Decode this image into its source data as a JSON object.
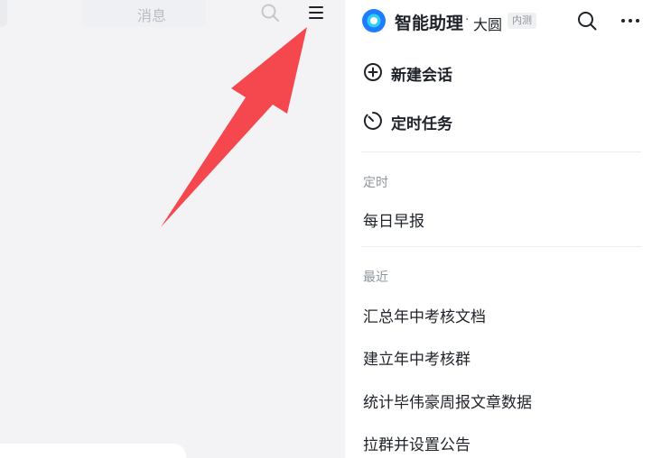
{
  "left": {
    "title": "消息"
  },
  "drawer": {
    "app_name": "智能助理",
    "separator": "·",
    "org_name": "大圆",
    "badge": "内测",
    "actions": {
      "new_chat": "新建会话",
      "scheduled_tasks": "定时任务"
    },
    "scheduled": {
      "header": "定时",
      "items": [
        "每日早报"
      ]
    },
    "recent": {
      "header": "最近",
      "items": [
        "汇总年中考核文档",
        "建立年中考核群",
        "统计毕伟豪周报文章数据",
        "拉群并设置公告"
      ]
    }
  },
  "colors": {
    "arrow": "#f5484e",
    "logo_outer": "#1f7cff",
    "logo_inner": "#2fd0f5",
    "text_primary": "#1f2329",
    "text_secondary": "#8f959e"
  }
}
